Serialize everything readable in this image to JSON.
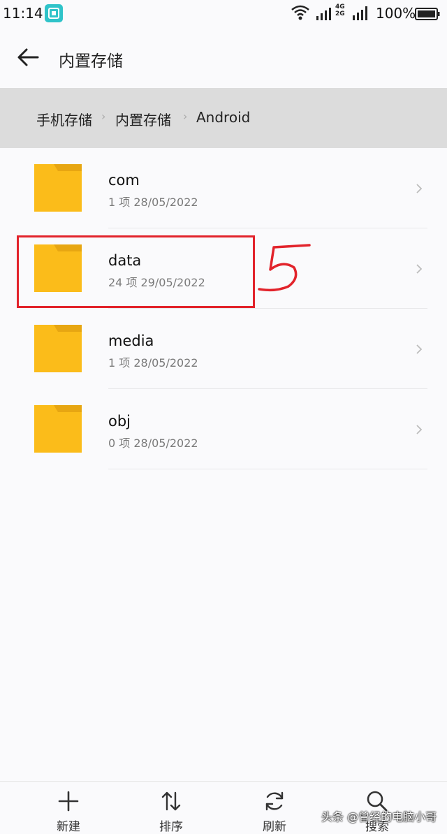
{
  "status_bar": {
    "time": "11:14",
    "network_type_top": "4G",
    "network_type_bottom": "2G",
    "battery": "100%"
  },
  "header": {
    "title": "内置存储"
  },
  "breadcrumb": [
    "手机存储",
    "内置存储",
    "Android"
  ],
  "folders": [
    {
      "name": "com",
      "meta": "1 项  28/05/2022"
    },
    {
      "name": "data",
      "meta": "24 项  29/05/2022"
    },
    {
      "name": "media",
      "meta": "1 项  28/05/2022"
    },
    {
      "name": "obj",
      "meta": "0 项  28/05/2022"
    }
  ],
  "toolbar": {
    "new_label": "新建",
    "sort_label": "排序",
    "refresh_label": "刷新",
    "search_label": "搜索"
  },
  "watermark": "头条 @曾经的电脑小哥",
  "colors": {
    "folder": "#fbbc1a",
    "folder_tab": "#e7a612",
    "annotation": "#e2232b",
    "breadcrumb_bg": "#dcdcdc"
  }
}
